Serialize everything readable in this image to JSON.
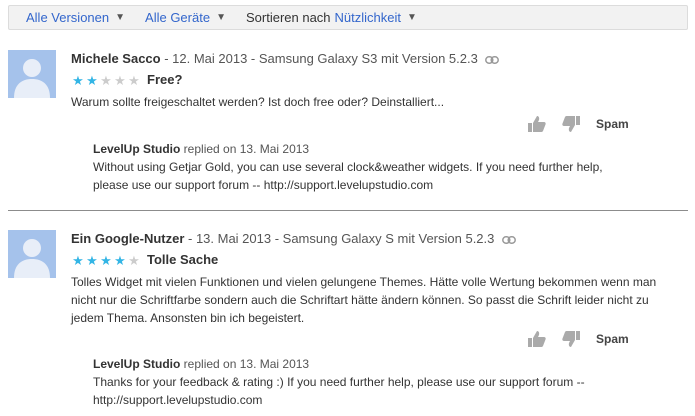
{
  "filters": {
    "versions": "Alle Versionen",
    "devices": "Alle Geräte",
    "sort_prefix": "Sortieren nach",
    "sort_value": "Nützlichkeit",
    "caret": "▼"
  },
  "reviews": [
    {
      "author": "Michele Sacco",
      "meta": " - 12. Mai 2013 - Samsung Galaxy S3 mit Version 5.2.3",
      "rating": 2,
      "max_rating": 5,
      "title": "Free?",
      "text": "Warum sollte freigeschaltet werden? Ist doch free oder? Deinstalliert...",
      "spam_label": "Spam",
      "reply": {
        "developer": "LevelUp Studio",
        "meta": " replied on 13. Mai 2013",
        "text": "Without using Getjar Gold, you can use several clock&weather widgets. If you need further help, please use our support forum -- http://support.levelupstudio.com"
      }
    },
    {
      "author": "Ein Google-Nutzer",
      "meta": " - 13. Mai 2013 - Samsung Galaxy S mit Version 5.2.3",
      "rating": 4,
      "max_rating": 5,
      "title": "Tolle Sache",
      "text": "Tolles Widget mit vielen Funktionen und vielen gelungene Themes. Hätte volle Wertung bekommen wenn man nicht nur die Schriftfarbe sondern auch die Schriftart hätte ändern können. So passt die Schrift leider nicht zu jedem Thema. Ansonsten bin ich begeistert.",
      "spam_label": "Spam",
      "reply": {
        "developer": "LevelUp Studio",
        "meta": " replied on 13. Mai 2013",
        "text": "Thanks for your feedback & rating :) If you need further help, please use our support forum -- http://support.levelupstudio.com"
      }
    }
  ],
  "icons": {
    "avatar": "default-user-avatar-icon",
    "link": "permalink-icon",
    "thumb_up": "thumbs-up-icon",
    "thumb_down": "thumbs-down-icon",
    "star": "star-icon"
  },
  "colors": {
    "link": "#3366cc",
    "star_on": "#33b5e5",
    "star_off": "#cccccc",
    "avatar_bg": "#a5c2eb"
  }
}
